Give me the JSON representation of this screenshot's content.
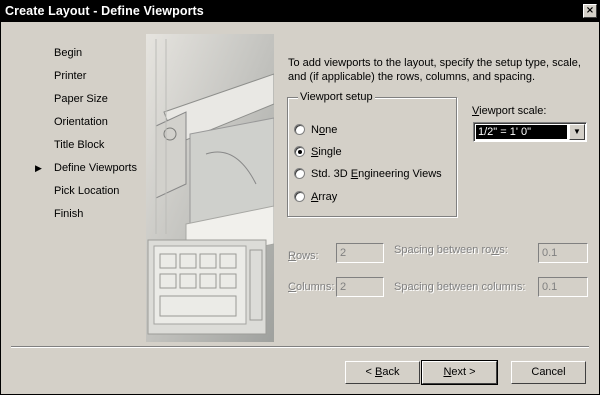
{
  "window": {
    "title": "Create Layout - Define Viewports",
    "close_glyph": "×"
  },
  "steps": [
    {
      "label": "Begin"
    },
    {
      "label": "Printer"
    },
    {
      "label": "Paper Size"
    },
    {
      "label": "Orientation"
    },
    {
      "label": "Title Block"
    },
    {
      "label": "Define Viewports",
      "current": true
    },
    {
      "label": "Pick Location"
    },
    {
      "label": "Finish"
    }
  ],
  "current_marker": "▶",
  "instructions": "To add viewports to the layout, specify the setup type, scale, and (if applicable) the rows, columns, and spacing.",
  "viewport_setup": {
    "legend": "Viewport setup",
    "options": [
      {
        "pre": "N",
        "key": "o",
        "post": "ne",
        "selected": false
      },
      {
        "pre": "",
        "key": "S",
        "post": "ingle",
        "selected": true
      },
      {
        "pre": "Std. 3D ",
        "key": "E",
        "post": "ngineering Views",
        "selected": false
      },
      {
        "pre": "",
        "key": "A",
        "post": "rray",
        "selected": false
      }
    ]
  },
  "viewport_scale": {
    "label_key": "V",
    "label_rest": "iewport scale:",
    "value": "1/2\" = 1' 0\""
  },
  "grid": {
    "rows": {
      "label_key": "R",
      "label_rest": "ows:",
      "value": "2"
    },
    "columns": {
      "label_key": "C",
      "label_rest": "olumns:",
      "value": "2"
    },
    "row_spacing": {
      "label_pre": "Spacing between ro",
      "label_key": "w",
      "label_post": "s:",
      "value": "0.1"
    },
    "column_spacing": {
      "label": "Spacing between columns:",
      "value": "0.1"
    }
  },
  "buttons": {
    "back": {
      "pre": "< ",
      "key": "B",
      "post": "ack"
    },
    "next": {
      "key": "N",
      "post": "ext >"
    },
    "cancel": "Cancel"
  }
}
